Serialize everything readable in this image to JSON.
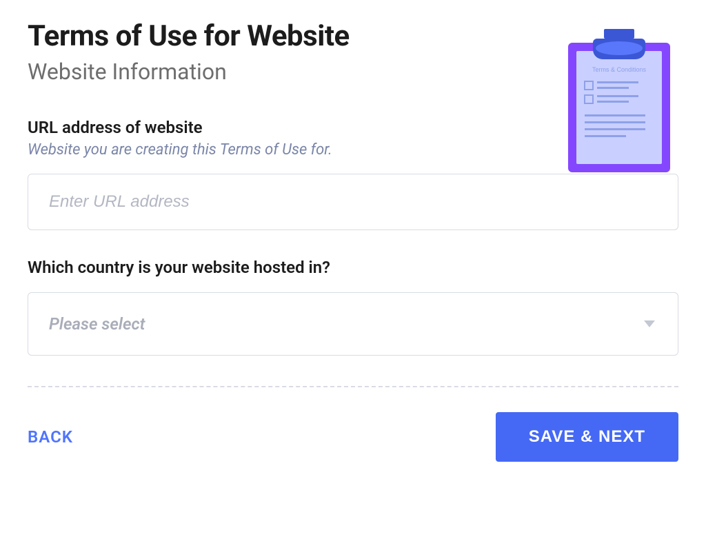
{
  "header": {
    "title": "Terms of Use for Website",
    "subtitle": "Website Information"
  },
  "illustration": {
    "doc_label": "Terms & Conditions"
  },
  "fields": {
    "url": {
      "label": "URL address of website",
      "hint": "Website you are creating this Terms of Use for.",
      "placeholder": "Enter URL address",
      "value": ""
    },
    "country": {
      "label": "Which country is your website hosted in?",
      "placeholder": "Please select",
      "value": ""
    }
  },
  "footer": {
    "back_label": "BACK",
    "next_label": "SAVE & NEXT"
  },
  "colors": {
    "primary": "#4569f5",
    "accent_purple": "#8447ff"
  }
}
